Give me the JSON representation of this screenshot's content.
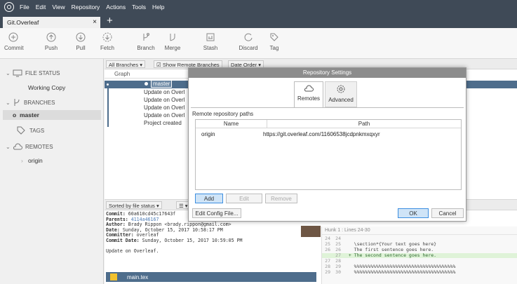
{
  "menu": {
    "items": [
      "File",
      "Edit",
      "View",
      "Repository",
      "Actions",
      "Tools",
      "Help"
    ]
  },
  "tabs": {
    "active": "Git.Overleaf",
    "close": "×",
    "new": "+"
  },
  "toolbar": {
    "commit": "Commit",
    "push": "Push",
    "pull": "Pull",
    "fetch": "Fetch",
    "branch": "Branch",
    "merge": "Merge",
    "stash": "Stash",
    "discard": "Discard",
    "tag": "Tag"
  },
  "sidebar": {
    "file_status": "FILE STATUS",
    "working_copy": "Working Copy",
    "branches": "BRANCHES",
    "master": "master",
    "tags": "TAGS",
    "remotes": "REMOTES",
    "origin": "origin"
  },
  "filters": {
    "all_branches": "All Branches",
    "show_remote": "Show Remote Branches",
    "date_order": "Date Order",
    "graph": "Graph"
  },
  "commits": [
    {
      "label": "master"
    },
    {
      "label": "Update on Overl"
    },
    {
      "label": "Update on Overl"
    },
    {
      "label": "Update on Overl"
    },
    {
      "label": "Update on Overl"
    },
    {
      "label": "Project created"
    }
  ],
  "sortbar": {
    "label": "Sorted by file status"
  },
  "details": {
    "commit_k": "Commit:",
    "commit_v": " 60a610cd45c17643f",
    "parents_k": "Parents:",
    "parents_v": " 4114a46167",
    "author_k": "Author:",
    "author_v": " Brady Rippon <brady.rippon@gmail.com>",
    "date_k": "Date:",
    "date_v": " Sunday, October 15, 2017 10:58:17 PM",
    "committer_k": "Committer:",
    "committer_v": " overleaf",
    "cdate_k": "Commit Date:",
    "cdate_v": " Sunday, October 15, 2017 10:59:05 PM",
    "message": "Update on Overleaf."
  },
  "file": {
    "name": "main.tex"
  },
  "hunk": {
    "header": "Hunk 1 : Lines 24-30",
    "lines": [
      {
        "a": "24",
        "b": "24",
        "t": ""
      },
      {
        "a": "25",
        "b": "25",
        "t": "    \\section*{Your text goes here}"
      },
      {
        "a": "26",
        "b": "26",
        "t": "    The first sentence goes here."
      },
      {
        "a": "",
        "b": "27",
        "t": "  + The second sentence goes here."
      },
      {
        "a": "27",
        "b": "28",
        "t": ""
      },
      {
        "a": "28",
        "b": "29",
        "t": "    %%%%%%%%%%%%%%%%%%%%%%%%%%%%%%%%%%%%%"
      },
      {
        "a": "29",
        "b": "30",
        "t": "    %%%%%%%%%%%%%%%%%%%%%%%%%%%%%%%%%%%%%"
      }
    ]
  },
  "modal": {
    "title": "Repository Settings",
    "tab_remotes": "Remotes",
    "tab_advanced": "Advanced",
    "section_label": "Remote repository paths",
    "col_name": "Name",
    "col_path": "Path",
    "rows": [
      {
        "name": "origin",
        "path": "https://git.overleaf.com/11606538jcdpnkmxqxyr"
      }
    ],
    "add": "Add",
    "edit": "Edit",
    "remove": "Remove",
    "edit_config": "Edit Config File...",
    "ok": "OK",
    "cancel": "Cancel"
  },
  "colors": {
    "accent": "#4e6d8c",
    "title_bar": "#3f4a57",
    "primary_button": "#3d8ee0"
  }
}
